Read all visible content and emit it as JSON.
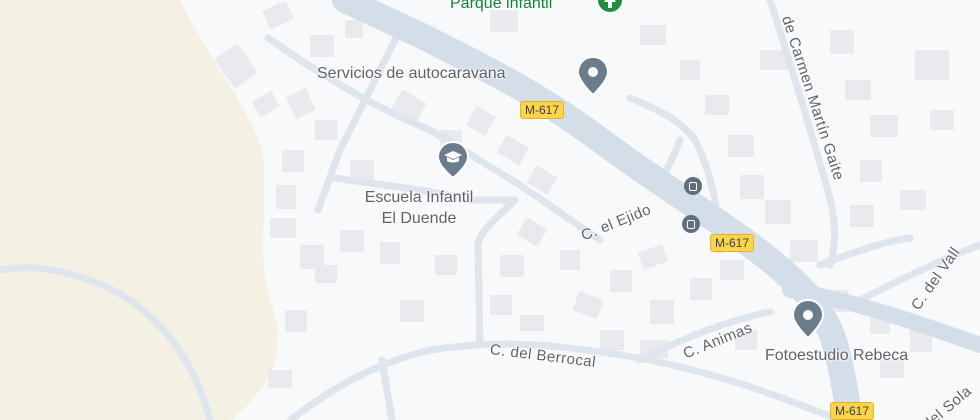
{
  "places": {
    "park": "Parque infantil",
    "services": "Servicios de autocaravana",
    "school_line1": "Escuela Infantil",
    "school_line2": "El Duende",
    "photo": "Fotoestudio Rebeca"
  },
  "streets": {
    "ejido": "C. el Ejido",
    "berrocal": "C. del Berrocal",
    "animas": "C. Animas",
    "carmen": "de Carmen Martín Gaite",
    "valle": "C. del Vall",
    "sol": "del Sola"
  },
  "road_shields": {
    "m617_a": "M-617",
    "m617_b": "M-617",
    "m617_c": "M-617"
  },
  "icons": {
    "park_pin": "tree-icon",
    "services_pin": "place-icon",
    "school_pin": "school-icon",
    "photo_pin": "place-icon",
    "bus_stop": "bus-icon"
  },
  "colors": {
    "background": "#f8f9fa",
    "open_land": "#f5f0e4",
    "major_road": "#d4dee8",
    "minor_road": "#dfe5ec",
    "building": "#e8eaed",
    "park_label": "#188038",
    "poi_pin": "#6b7c8c",
    "road_shield": "#fcd34d"
  }
}
